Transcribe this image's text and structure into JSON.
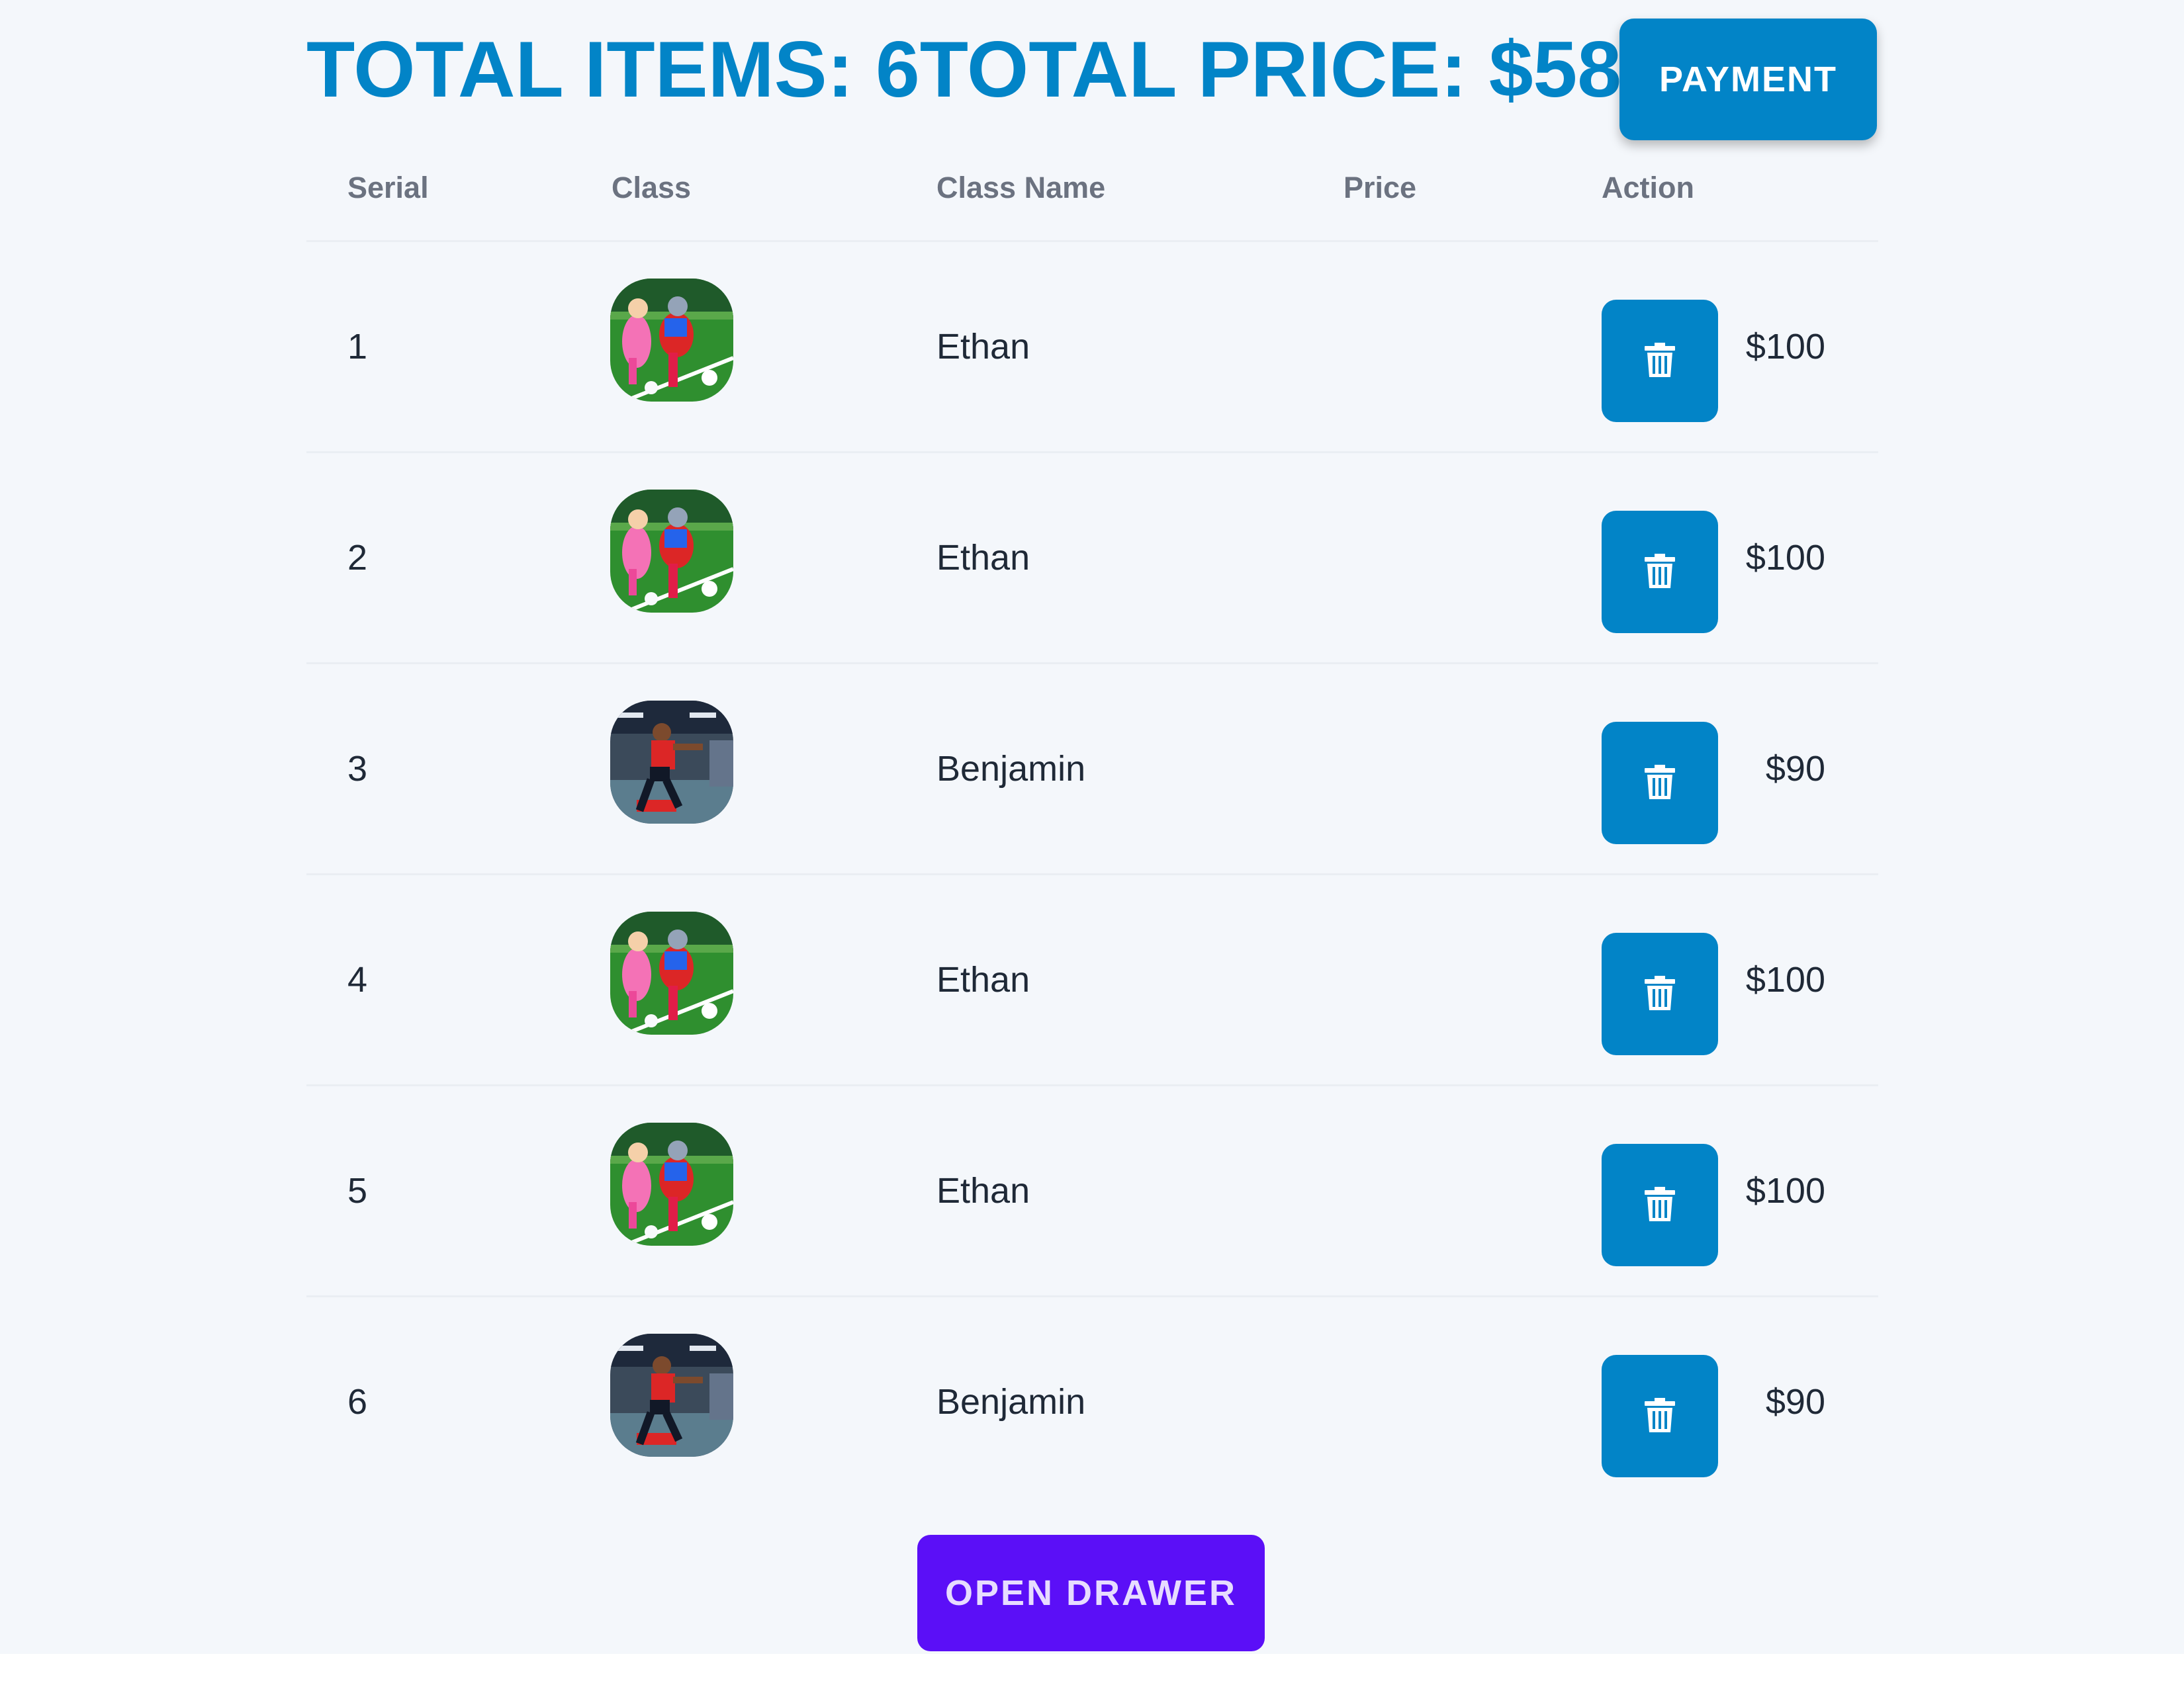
{
  "summary": {
    "items_text": "TOTAL ITEMS: 6",
    "price_text": "TOTAL PRICE: $580"
  },
  "payment_button": {
    "label": "PAYMENT"
  },
  "table": {
    "headers": {
      "serial": "Serial",
      "class": "Class",
      "class_name": "Class Name",
      "price": "Price",
      "action": "Action"
    },
    "rows": [
      {
        "serial": "1",
        "class_name": "Ethan",
        "price": "$100",
        "image": "soccer-kids-photo"
      },
      {
        "serial": "2",
        "class_name": "Ethan",
        "price": "$100",
        "image": "soccer-kids-photo"
      },
      {
        "serial": "3",
        "class_name": "Benjamin",
        "price": "$90",
        "image": "indoor-kick-photo"
      },
      {
        "serial": "4",
        "class_name": "Ethan",
        "price": "$100",
        "image": "soccer-kids-photo"
      },
      {
        "serial": "5",
        "class_name": "Ethan",
        "price": "$100",
        "image": "soccer-kids-photo"
      },
      {
        "serial": "6",
        "class_name": "Benjamin",
        "price": "$90",
        "image": "indoor-kick-photo"
      }
    ]
  },
  "drawer_button": {
    "label": "OPEN DRAWER"
  },
  "colors": {
    "accent": "#0284c7",
    "drawer": "#5b0ff7",
    "background": "#f4f7fb"
  }
}
